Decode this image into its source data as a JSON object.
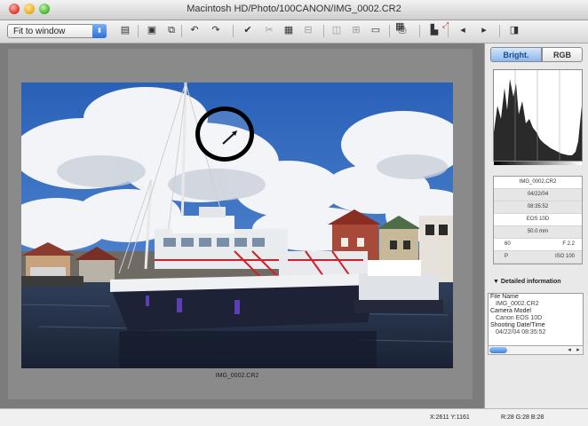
{
  "window": {
    "title": "Macintosh HD/Photo/100CANON/IMG_0002.CR2"
  },
  "toolbar": {
    "zoom_value": "Fit to window",
    "zoom_arrow": "⬍",
    "icons": [
      {
        "name": "film-strip-icon",
        "glyph": "▤",
        "dim": false
      },
      {
        "name": "single-view-icon",
        "glyph": "▣",
        "dim": false
      },
      {
        "name": "layout-icon",
        "glyph": "⧉",
        "dim": false
      },
      {
        "name": "rotate-left-icon",
        "glyph": "↶",
        "dim": false
      },
      {
        "name": "rotate-right-icon",
        "glyph": "↷",
        "dim": false
      },
      {
        "name": "check-mark-icon",
        "glyph": "✔",
        "dim": false
      },
      {
        "name": "cut-icon",
        "glyph": "✂",
        "dim": true
      },
      {
        "name": "save-icon",
        "glyph": "▦",
        "dim": false
      },
      {
        "name": "trim-icon",
        "glyph": "⊟",
        "dim": true
      },
      {
        "name": "compare-icon",
        "glyph": "◫",
        "dim": true
      },
      {
        "name": "grid-icon",
        "glyph": "⊞",
        "dim": true
      },
      {
        "name": "image-icon",
        "glyph": "▭",
        "dim": false
      },
      {
        "name": "print-icon",
        "glyph": "⎙",
        "dim": false
      },
      {
        "name": "folder-icon",
        "glyph": "▙",
        "dim": false
      },
      {
        "name": "previous-icon",
        "glyph": "◂",
        "dim": false
      },
      {
        "name": "next-icon",
        "glyph": "▸",
        "dim": false
      },
      {
        "name": "tool-palette-icon",
        "glyph": "◨",
        "dim": false
      }
    ]
  },
  "viewer": {
    "caption": "IMG_0002.CR2",
    "grid_icon": "▦",
    "expand_icon": "⤢"
  },
  "panel": {
    "tabs": [
      {
        "label": "Bright.",
        "active": true
      },
      {
        "label": "RGB",
        "active": false
      }
    ],
    "info": {
      "filename": "IMG_0002.CR2",
      "date": "04/22/04",
      "time": "08:35:52",
      "camera": "EOS 10D",
      "focal": "50.0 mm",
      "tv_label": "60",
      "av_label": "F 2.2",
      "mode_label": "P",
      "iso_label": "ISO 100"
    },
    "detail_header": "▼ Detailed information",
    "detail_lines": [
      {
        "text": "File Name",
        "val": false
      },
      {
        "text": "IMG_0002.CR2",
        "val": true
      },
      {
        "text": "Camera Model",
        "val": false
      },
      {
        "text": "Canon EOS 10D",
        "val": true
      },
      {
        "text": "Shooting Date/Time",
        "val": false
      },
      {
        "text": "04/22/04 08:35:52",
        "val": true
      }
    ],
    "scroll_left": "◂",
    "scroll_right": "▸"
  },
  "status": {
    "coords": "X:2611 Y:1161",
    "rgb": "R:28 G:28 B:28"
  },
  "colors": {
    "accent": "#3c7fe0",
    "tab_active": "#8db6ea",
    "sky": "#3c72c4"
  }
}
